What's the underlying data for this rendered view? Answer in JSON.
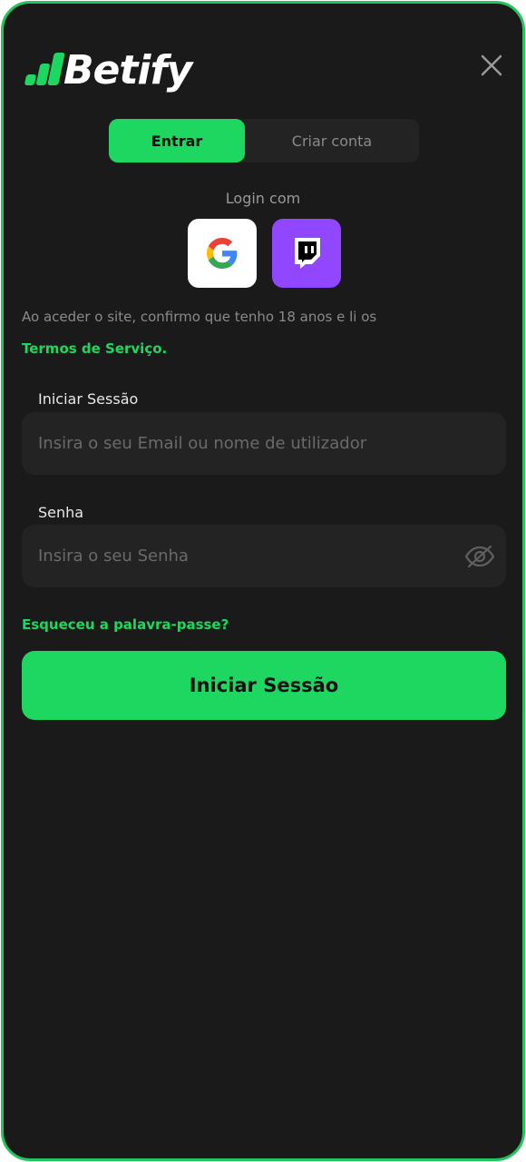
{
  "brand": {
    "name": "Betify",
    "accent_color": "#1ed760",
    "background_color": "#1a1a1b"
  },
  "header": {
    "close_icon": "close-icon"
  },
  "tabs": [
    {
      "label": "Entrar",
      "active": true
    },
    {
      "label": "Criar conta",
      "active": false
    }
  ],
  "social_login": {
    "label": "Login com",
    "providers": [
      {
        "name": "Google",
        "icon": "google-icon"
      },
      {
        "name": "Twitch",
        "icon": "twitch-icon"
      }
    ]
  },
  "consent": {
    "text": "Ao aceder o site, confirmo que tenho 18 anos e li os",
    "link_label": "Termos de Serviço."
  },
  "form": {
    "session_label": "Iniciar Sessão",
    "session_placeholder": "Insira o seu Email ou nome de utilizador",
    "session_value": "",
    "password_label": "Senha",
    "password_placeholder": "Insira o seu Senha",
    "password_value": "",
    "password_toggle_icon": "eye-off-icon",
    "forgot_label": "Esqueceu a palavra-passe?",
    "submit_label": "Iniciar Sessão"
  }
}
